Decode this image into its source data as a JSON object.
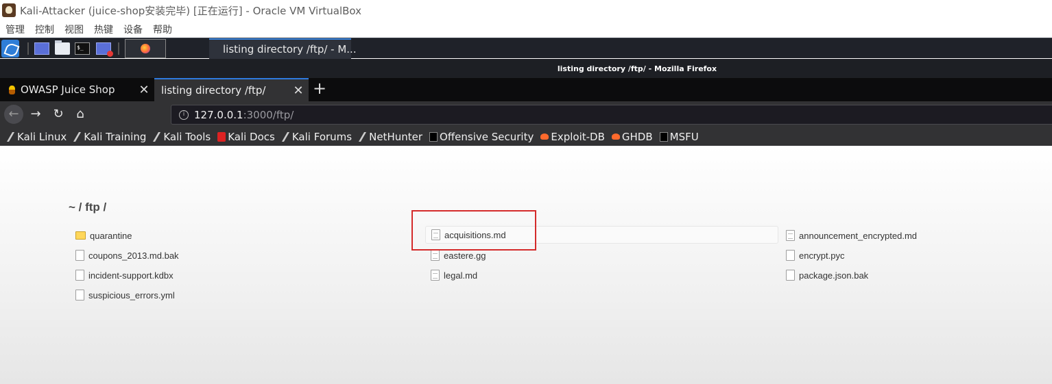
{
  "vbox": {
    "title": "Kali-Attacker (juice-shop安装完毕) [正在运行] - Oracle VM VirtualBox",
    "menu": [
      "管理",
      "控制",
      "视图",
      "热键",
      "设备",
      "帮助"
    ]
  },
  "panel": {
    "active_window_title": "listing directory /ftp/ - M..."
  },
  "firefox": {
    "window_title": "listing directory /ftp/ - Mozilla Firefox",
    "tabs": [
      {
        "label": "OWASP Juice Shop",
        "close": "✕"
      },
      {
        "label": "listing directory /ftp/",
        "close": "✕"
      }
    ],
    "new_tab": "+",
    "nav": {
      "back": "←",
      "forward": "→",
      "reload": "↻",
      "home": "⌂"
    },
    "url": {
      "host": "127.0.0.1",
      "rest": ":3000/ftp/",
      "info": "i"
    },
    "bookmarks": [
      "Kali Linux",
      "Kali Training",
      "Kali Tools",
      "Kali Docs",
      "Kali Forums",
      "NetHunter",
      "Offensive Security",
      "Exploit-DB",
      "GHDB",
      "MSFU"
    ]
  },
  "listing": {
    "breadcrumb": "~ / ftp /",
    "files": [
      {
        "name": "quarantine",
        "icon": "folder-icon"
      },
      {
        "name": "acquisitions.md",
        "icon": "document-icon"
      },
      {
        "name": "announcement_encrypted.md",
        "icon": "document-icon"
      },
      {
        "name": "coupons_2013.md.bak",
        "icon": "file-icon"
      },
      {
        "name": "eastere.gg",
        "icon": "document-icon"
      },
      {
        "name": "encrypt.pyc",
        "icon": "file-icon"
      },
      {
        "name": "incident-support.kdbx",
        "icon": "file-icon"
      },
      {
        "name": "legal.md",
        "icon": "document-icon"
      },
      {
        "name": "package.json.bak",
        "icon": "file-icon"
      },
      {
        "name": "suspicious_errors.yml",
        "icon": "file-icon"
      }
    ]
  },
  "colors": {
    "highlight": "#d42a2a",
    "tab_accent": "#2e7ae0",
    "panel_bg": "#1f2229"
  }
}
